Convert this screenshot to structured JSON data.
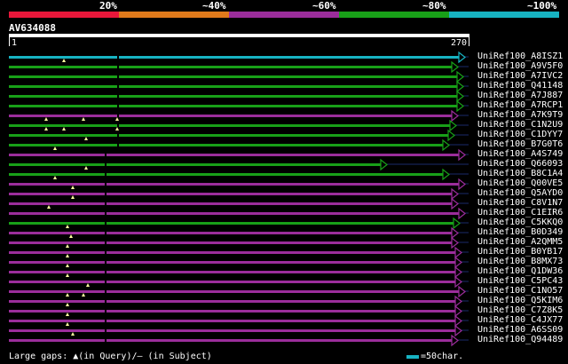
{
  "legend": {
    "labels": [
      "20%",
      "~40%",
      "~60%",
      "~80%",
      "~100%"
    ],
    "colors": [
      "#e8173a",
      "#e07a1b",
      "#9b2d9b",
      "#18a018",
      "#17b3c2"
    ]
  },
  "query": {
    "name": "AV634088",
    "start": "1",
    "end": "270"
  },
  "hits": [
    {
      "label": "UniRef100_A8ISZ1",
      "color": "#17b3c2",
      "end": 524,
      "marks": []
    },
    {
      "label": "UniRef100_A9V5F0",
      "color": "#18a018",
      "end": 516,
      "marks": [
        72
      ]
    },
    {
      "label": "UniRef100_A7IVC2",
      "color": "#18a018",
      "end": 522,
      "marks": []
    },
    {
      "label": "UniRef100_Q41148",
      "color": "#18a018",
      "end": 522,
      "marks": []
    },
    {
      "label": "UniRef100_A7J887",
      "color": "#18a018",
      "end": 522,
      "marks": []
    },
    {
      "label": "UniRef100_A7RCP1",
      "color": "#18a018",
      "end": 522,
      "marks": []
    },
    {
      "label": "UniRef100_A7K9T9",
      "color": "#9b2d9b",
      "end": 516,
      "marks": []
    },
    {
      "label": "UniRef100_C1N2U9",
      "color": "#18a018",
      "end": 514,
      "marks": [
        52,
        94,
        132
      ]
    },
    {
      "label": "UniRef100_C1DYY7",
      "color": "#18a018",
      "end": 512,
      "marks": [
        52,
        72,
        132
      ]
    },
    {
      "label": "UniRef100_B7G0T6",
      "color": "#18a018",
      "end": 506,
      "marks": [
        97
      ]
    },
    {
      "label": "UniRef100_A4S749",
      "color": "#9b2d9b",
      "end": 524,
      "marks": [
        62
      ]
    },
    {
      "label": "UniRef100_Q66093",
      "color": "#18a018",
      "end": 436,
      "marks": []
    },
    {
      "label": "UniRef100_B8C1A4",
      "color": "#18a018",
      "end": 506,
      "marks": [
        97
      ]
    },
    {
      "label": "UniRef100_Q00VE5",
      "color": "#9b2d9b",
      "end": 524,
      "marks": [
        62
      ]
    },
    {
      "label": "UniRef100_Q5AYD0",
      "color": "#9b2d9b",
      "end": 516,
      "marks": [
        82
      ]
    },
    {
      "label": "UniRef100_C8V1N7",
      "color": "#9b2d9b",
      "end": 516,
      "marks": [
        82
      ]
    },
    {
      "label": "UniRef100_C1EIR6",
      "color": "#9b2d9b",
      "end": 524,
      "marks": [
        55
      ]
    },
    {
      "label": "UniRef100_C5KKQ0",
      "color": "#18a018",
      "end": 518,
      "marks": []
    },
    {
      "label": "UniRef100_B0D349",
      "color": "#9b2d9b",
      "end": 516,
      "marks": [
        76
      ]
    },
    {
      "label": "UniRef100_A2QMM5",
      "color": "#9b2d9b",
      "end": 516,
      "marks": [
        80
      ]
    },
    {
      "label": "UniRef100_B0YB17",
      "color": "#9b2d9b",
      "end": 520,
      "marks": [
        76
      ]
    },
    {
      "label": "UniRef100_B8MX73",
      "color": "#9b2d9b",
      "end": 520,
      "marks": [
        76
      ]
    },
    {
      "label": "UniRef100_Q1DW36",
      "color": "#9b2d9b",
      "end": 520,
      "marks": [
        76
      ]
    },
    {
      "label": "UniRef100_C5PC43",
      "color": "#9b2d9b",
      "end": 520,
      "marks": [
        76
      ]
    },
    {
      "label": "UniRef100_C1NO57",
      "color": "#9b2d9b",
      "end": 524,
      "marks": [
        99
      ]
    },
    {
      "label": "UniRef100_Q5KIM6",
      "color": "#9b2d9b",
      "end": 520,
      "marks": [
        76,
        94
      ]
    },
    {
      "label": "UniRef100_C7Z8K5",
      "color": "#9b2d9b",
      "end": 520,
      "marks": [
        76
      ]
    },
    {
      "label": "UniRef100_C4JX77",
      "color": "#9b2d9b",
      "end": 520,
      "marks": [
        76
      ]
    },
    {
      "label": "UniRef100_A6SS09",
      "color": "#9b2d9b",
      "end": 520,
      "marks": [
        76
      ]
    },
    {
      "label": "UniRef100_Q94489",
      "color": "#9b2d9b",
      "end": 516,
      "marks": [
        82
      ]
    }
  ],
  "footer": {
    "left": "Large gaps: ▲(in Query)/— (in Subject)",
    "right": "=50char.",
    "scale_color": "#17b3c2"
  }
}
